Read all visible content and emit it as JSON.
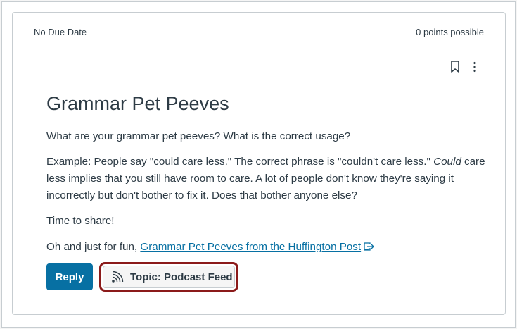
{
  "meta": {
    "due_date": "No Due Date",
    "points": "0 points possible"
  },
  "toolbar": {
    "bookmark_icon": "bookmark-icon",
    "more_icon": "kebab-menu-icon"
  },
  "discussion": {
    "title": "Grammar Pet Peeves",
    "paragraph1": "What are your grammar pet peeves? What is the correct usage?",
    "paragraph2_part1": "Example: People say \"could care less.\" The correct phrase is \"couldn't care less.\" ",
    "paragraph2_emphasis": "Could",
    "paragraph2_part2": " care less implies that you still have room to care. A lot of people don't know they're saying it incorrectly but don't bother to fix it. Does that bother anyone else?",
    "paragraph3": "Time to share!",
    "paragraph4_prefix": "Oh and just for fun, ",
    "link_text": "Grammar Pet Peeves from the Huffington Post",
    "link_icon": "external-link-icon"
  },
  "actions": {
    "reply_label": "Reply",
    "topic_label": "Topic: Podcast Feed",
    "topic_icon": "rss-feed-icon"
  },
  "colors": {
    "accent": "#0770a3",
    "highlight_outline": "#8b1a1a"
  }
}
